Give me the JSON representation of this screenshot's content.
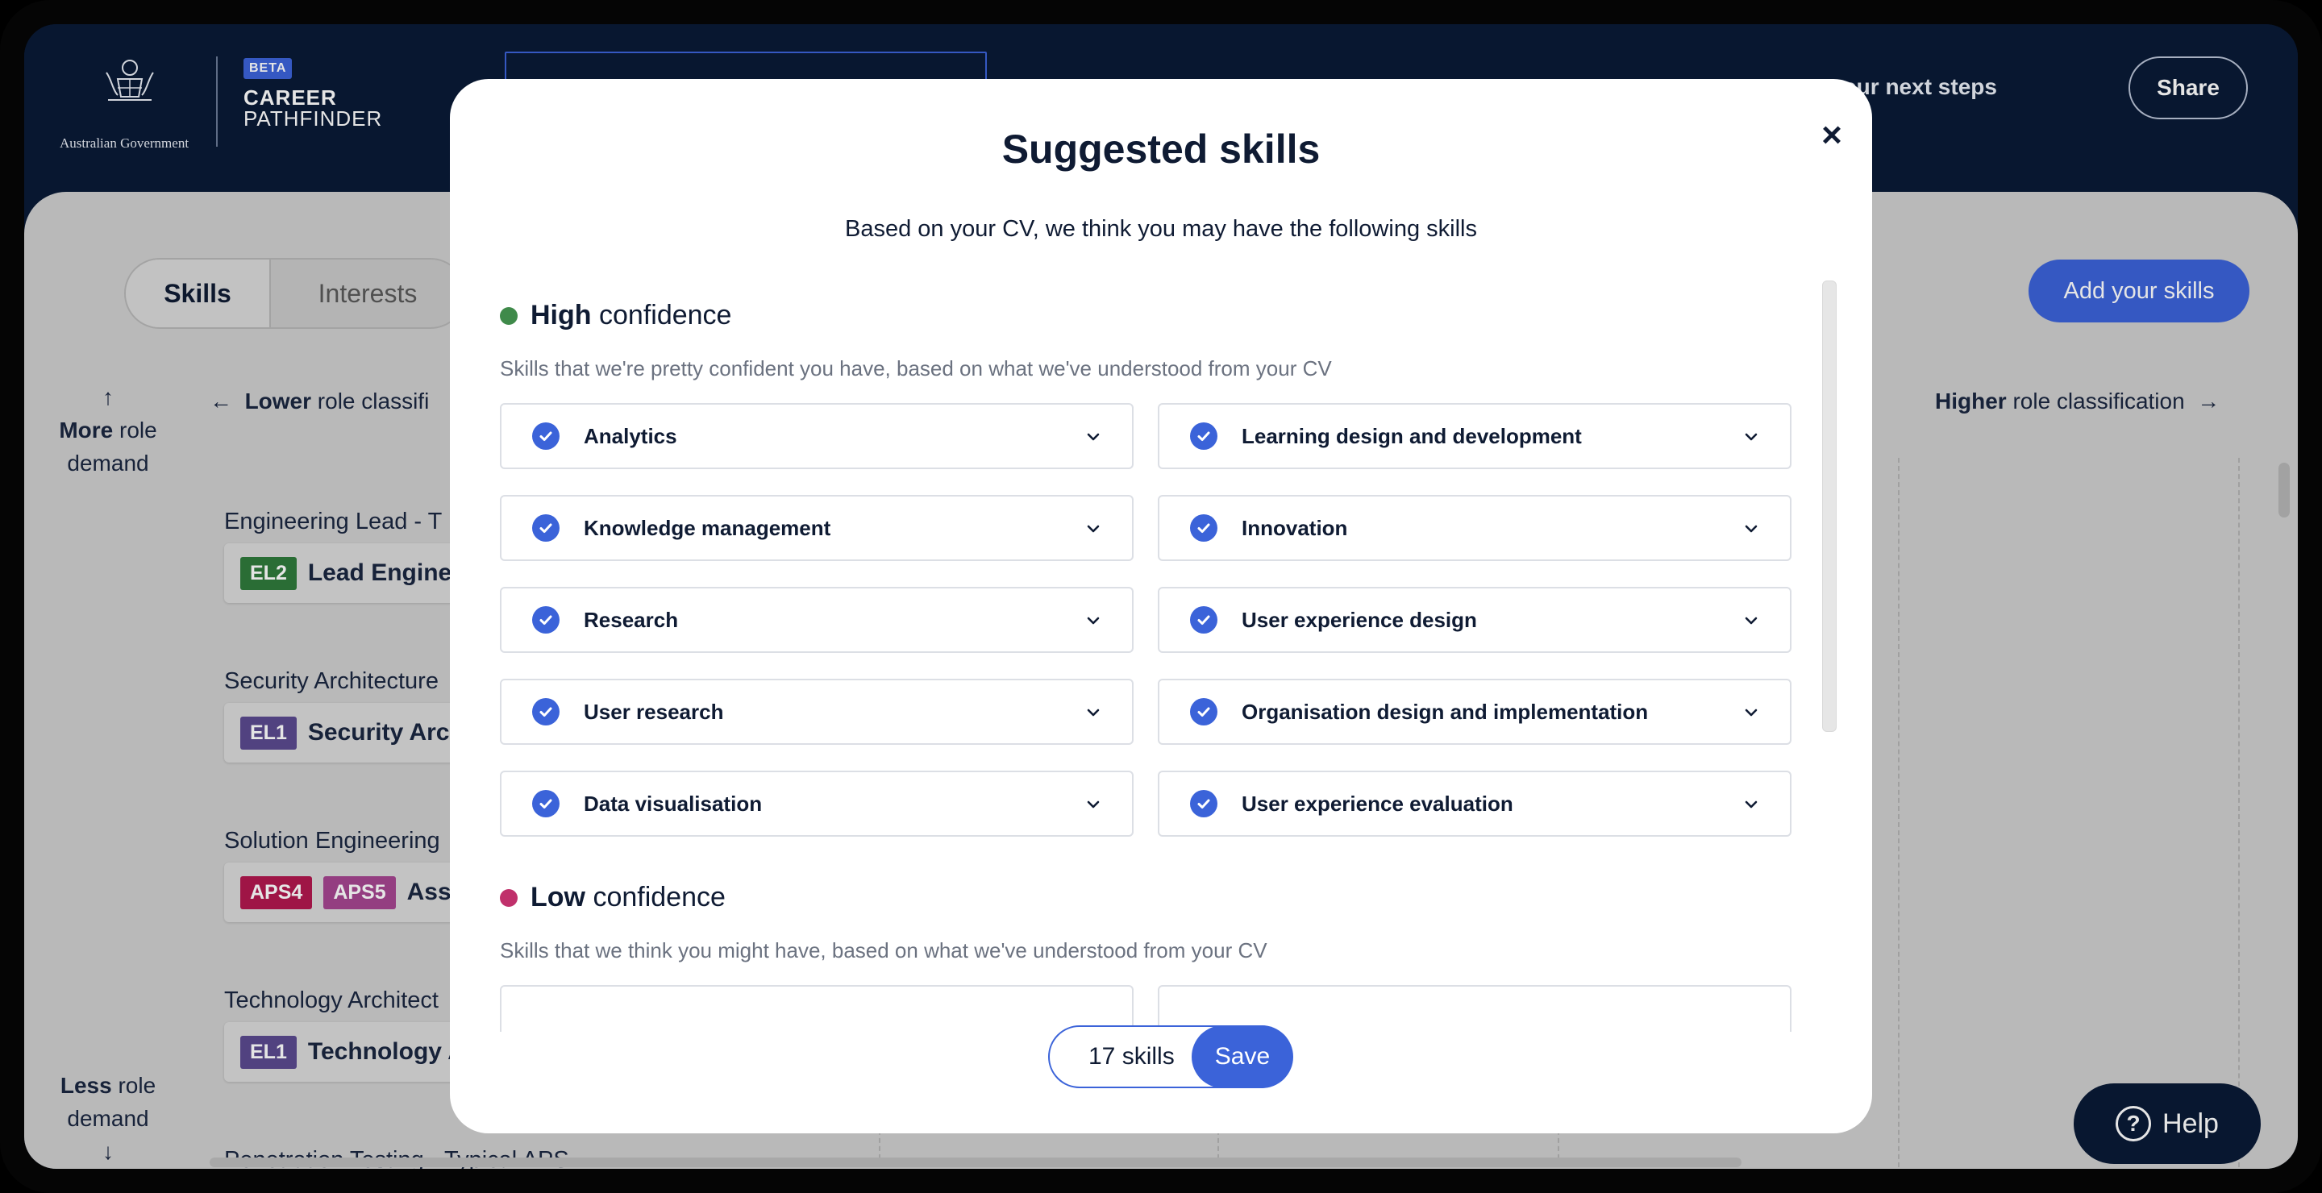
{
  "header": {
    "gov_name": "Australian Government",
    "beta": "BETA",
    "brand_line1": "CAREER",
    "brand_line2": "PATHFINDER",
    "next_steps": "your next steps",
    "share": "Share"
  },
  "background": {
    "tabs": [
      "Skills",
      "Interests"
    ],
    "add_skills": "Add your skills",
    "more_demand": [
      "↑",
      "More role",
      "demand"
    ],
    "less_demand": [
      "Less role",
      "demand",
      "↓"
    ],
    "lower_class": "← Lower role classifi",
    "higher_class": "Higher role classification →",
    "roles": [
      {
        "title": "Engineering Lead - T",
        "grades": [
          "EL2"
        ],
        "name": "Lead Engine"
      },
      {
        "title": "Security Architecture",
        "grades": [
          "EL1"
        ],
        "name": "Security Arch"
      },
      {
        "title": "Solution Engineering",
        "grades": [
          "APS4",
          "APS5"
        ],
        "name": "Ass"
      },
      {
        "title": "Technology Architect",
        "grades": [
          "EL1"
        ],
        "name": "Technology A"
      },
      {
        "title": "Penetration Testing - Typical APS",
        "grades": [],
        "name": ""
      }
    ],
    "help": "Help"
  },
  "modal": {
    "title": "Suggested skills",
    "subtitle": "Based on your CV, we think you may have the following skills",
    "high": {
      "bold": "High",
      "rest": "confidence",
      "desc": "Skills that we're pretty confident you have, based on what we've understood from your CV",
      "skills": [
        "Analytics",
        "Learning design and development",
        "Knowledge management",
        "Innovation",
        "Research",
        "User experience design",
        "User research",
        "Organisation design and implementation",
        "Data visualisation",
        "User experience evaluation"
      ]
    },
    "low": {
      "bold": "Low",
      "rest": "confidence",
      "desc": "Skills that we think you might have, based on what we've understood from your CV"
    },
    "count": "17 skills",
    "save": "Save",
    "close": "×"
  },
  "colors": {
    "accent": "#3b63d9",
    "header_bg": "#0a1a36",
    "high_dot": "#3f8a4a",
    "low_dot": "#c0306b"
  }
}
